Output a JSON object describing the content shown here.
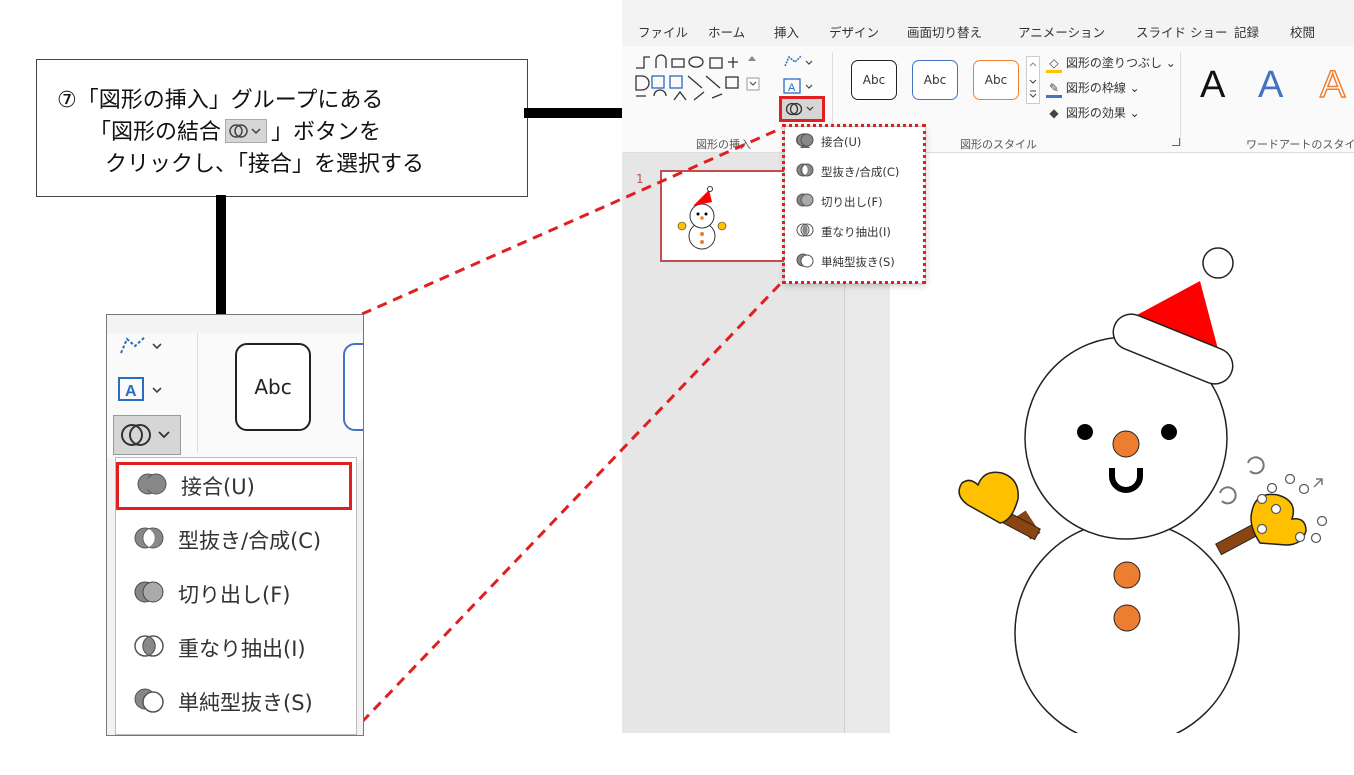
{
  "callout": {
    "line1": "⑦「図形の挿入」グループにある",
    "line2_before": "「図形の結合",
    "line2_after": "」ボタンを",
    "line3": "クリックし、「接合」を選択する"
  },
  "ribbon": {
    "tabs": [
      "ファイル",
      "ホーム",
      "挿入",
      "デザイン",
      "画面切り替え",
      "アニメーション",
      "スライド ショー",
      "記録",
      "校閲"
    ],
    "groups": {
      "insert_shapes": "図形の挿入",
      "shape_styles": "図形のスタイル",
      "wordart_styles": "ワードアートのスタイ"
    },
    "style_boxes": [
      "Abc",
      "Abc",
      "Abc"
    ],
    "shape_options": {
      "fill": "図形の塗りつぶし",
      "outline": "図形の枠線",
      "effects": "図形の効果"
    },
    "wordart_letters": [
      "A",
      "A",
      "A"
    ]
  },
  "merge_menu": {
    "items": [
      {
        "label": "接合(U)",
        "icon": "union-icon"
      },
      {
        "label": "型抜き/合成(C)",
        "icon": "combine-icon"
      },
      {
        "label": "切り出し(F)",
        "icon": "fragment-icon"
      },
      {
        "label": "重なり抽出(I)",
        "icon": "intersect-icon"
      },
      {
        "label": "単純型抜き(S)",
        "icon": "subtract-icon"
      }
    ]
  },
  "zoom": {
    "style_box": "Abc"
  },
  "slides": {
    "thumbnail_number": "1"
  },
  "colors": {
    "highlight_red": "#e02020",
    "hat_red": "#ff0000",
    "nose_orange": "#ed7d31",
    "mitten_yellow": "#ffc000",
    "arm_brown": "#8b4513",
    "thumb_border": "#c0504d"
  }
}
